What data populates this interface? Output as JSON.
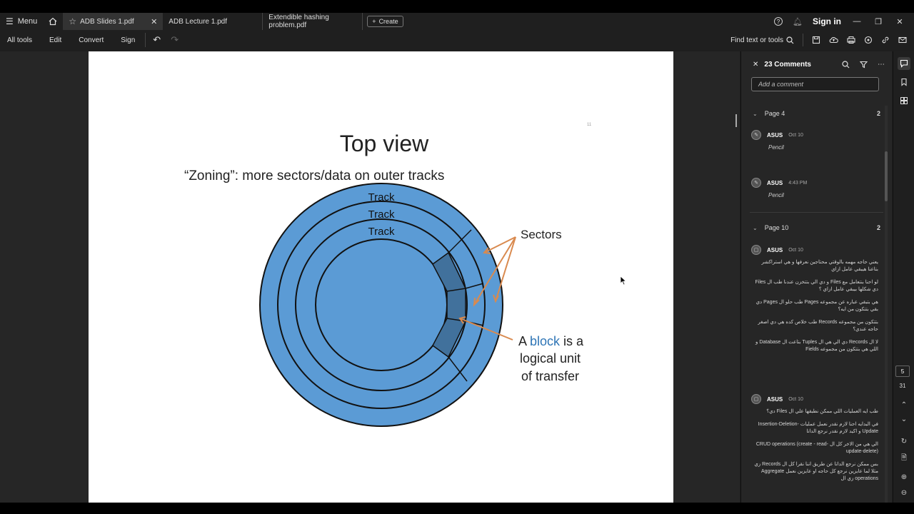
{
  "tabs": {
    "menu_label": "Menu",
    "items": [
      {
        "label": "ADB Slides 1.pdf"
      },
      {
        "label": "ADB Lecture 1.pdf"
      },
      {
        "label": "Extendible hashing problem.pdf"
      }
    ],
    "create_label": "Create",
    "sign_in": "Sign in"
  },
  "toolbar": {
    "all_tools": "All tools",
    "edit": "Edit",
    "convert": "Convert",
    "sign": "Sign",
    "find": "Find text or tools"
  },
  "slide": {
    "page_marker": "11",
    "title": "Top view",
    "subtitle": "“Zoning”: more sectors/data on outer tracks",
    "track_labels": [
      "Track",
      "Track",
      "Track"
    ],
    "sectors_label": "Sectors",
    "block_line1_prefix": "A ",
    "block_word": "block",
    "block_line1_suffix": " is a",
    "block_line2": "logical unit",
    "block_line3": "of transfer",
    "colors": {
      "disk_fill": "#5b9bd5",
      "sector_fill": "#41719c",
      "arrow": "#d98a4f",
      "block_word": "#2e75b6"
    }
  },
  "comments_panel": {
    "title": "23 Comments",
    "add_placeholder": "Add a comment",
    "groups": [
      {
        "label": "Page 4",
        "count": "2",
        "comments": [
          {
            "author": "ASUS",
            "date": "Oct 10",
            "body": "Pencil"
          },
          {
            "author": "ASUS",
            "date": "4:43 PM",
            "body": "Pencil"
          }
        ]
      },
      {
        "label": "Page 10",
        "count": "2",
        "comments": [
          {
            "author": "ASUS",
            "date": "Oct 10",
            "paragraphs": [
              "يعني حاجه مهمه بالوقتي محتاجين نعرفها و هي استراكشر بتاعنا هيبقي عامل ازاي",
              "لو احنا بنتعامل مع Files و دي الي بتتخزن عندنا طب ال Files دي شكلها بيبقي عامل ازاي ؟",
              "هي بتبقي عباره عن مجموعه Pages طب حلو ال Pages دي بقي بتتكون من ايه؟",
              "بتتكون من مجموعه Records طب خلاص كده هي دي اصغر حاجه عندي؟",
              "لا ال Records دي الي هي ال Tuples بتاعت ال Database و اللي هي بتتكون من مجموعه Fields"
            ]
          },
          {
            "author": "ASUS",
            "date": "Oct 10",
            "paragraphs": [
              "طب ايه العمليات اللي ممكن نطبقها علي ال Files دي؟",
              "في البدايه احنا لازم نقدر نعمل عمليات Insertion-Deletion-Update و اكيد لازم نقدر نرجع الداتا",
              "الي هي من الاخر كل ال CRUD operations (create - read- update-delete)",
              "بس ممكن نرجع الداتا عن طريق اننا نقرا كل ال Records زي مثلا لما عايزين نرجع كل حاجه او عايزين نعمل Aggregate operations زي ال"
            ]
          }
        ]
      }
    ]
  },
  "nav": {
    "current_page": "5",
    "total_pages": "31"
  }
}
